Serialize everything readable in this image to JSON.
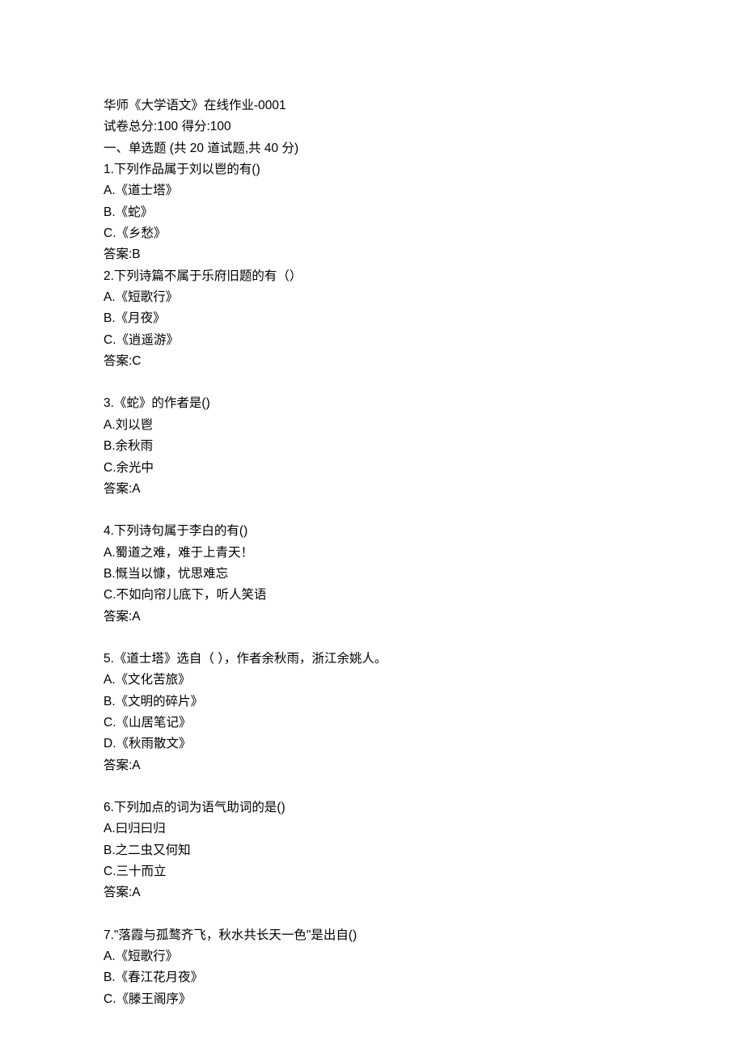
{
  "header": {
    "title": "华师《大学语文》在线作业-0001",
    "total_score_line": "试卷总分:100   得分:100",
    "section_title": "一、单选题 (共 20 道试题,共 40 分)"
  },
  "questions": [
    {
      "stem": "1.下列作品属于刘以鬯的有()",
      "options": [
        "A.《道士塔》",
        "B.《蛇》",
        "C.《乡愁》"
      ],
      "answer": "答案:B"
    },
    {
      "stem": "2.下列诗篇不属于乐府旧题的有（）",
      "options": [
        "A.《短歌行》",
        "B.《月夜》",
        "C.《逍遥游》"
      ],
      "answer": "答案:C"
    },
    {
      "stem": "3.《蛇》的作者是()",
      "options": [
        "A.刘以鬯",
        "B.余秋雨",
        "C.余光中"
      ],
      "answer": "答案:A"
    },
    {
      "stem": "4.下列诗句属于李白的有()",
      "options": [
        "A.蜀道之难，难于上青天！",
        "B.慨当以慷，忧思难忘",
        "C.不如向帘儿底下，听人笑语"
      ],
      "answer": "答案:A"
    },
    {
      "stem": "5.《道士塔》选自（ ），作者余秋雨，浙江余姚人。",
      "options": [
        "A.《文化苦旅》",
        "B.《文明的碎片》",
        "C.《山居笔记》",
        "D.《秋雨散文》"
      ],
      "answer": "答案:A"
    },
    {
      "stem": "6.下列加点的词为语气助词的是()",
      "options": [
        "A.曰归曰归",
        "B.之二虫又何知",
        "C.三十而立"
      ],
      "answer": "答案:A"
    },
    {
      "stem": "7.\"落霞与孤鹜齐飞，秋水共长天一色\"是出自()",
      "options": [
        "A.《短歌行》",
        "B.《春江花月夜》",
        "C.《滕王阁序》"
      ],
      "answer": ""
    }
  ]
}
